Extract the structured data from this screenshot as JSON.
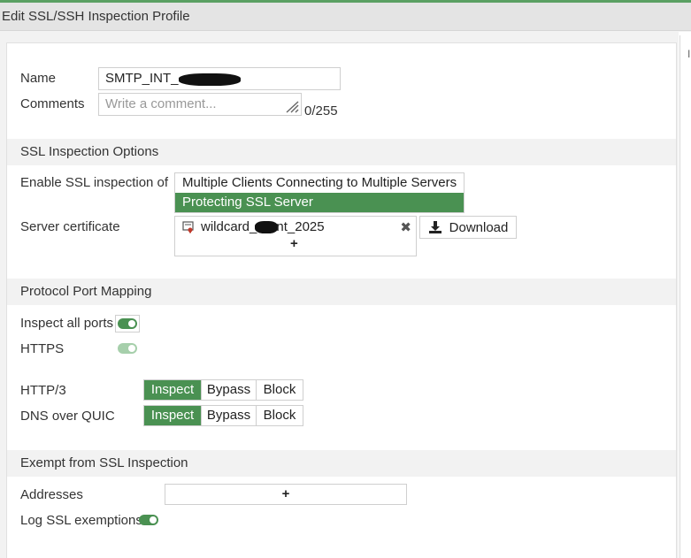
{
  "title": "Edit SSL/SSH Inspection Profile",
  "colors": {
    "accent": "#4a9152",
    "header_bg": "#e4e4e4",
    "section_bg": "#f2f2f2"
  },
  "form": {
    "name_label": "Name",
    "name_value": "SMTP_INT_",
    "comments_label": "Comments",
    "comments_placeholder": "Write a comment...",
    "comments_counter": "0/255"
  },
  "ssl_options": {
    "section_title": "SSL Inspection Options",
    "enable_label": "Enable SSL inspection of",
    "options": [
      {
        "label": "Multiple Clients Connecting to Multiple Servers",
        "selected": false
      },
      {
        "label": "Protecting SSL Server",
        "selected": true
      }
    ],
    "server_cert_label": "Server certificate",
    "cert_prefix": "wildcard_",
    "cert_suffix": "nt_2025",
    "cert_icon": "certificate-icon",
    "remove_icon": "close-icon",
    "add_symbol": "+",
    "download_label": "Download",
    "download_icon": "download-icon"
  },
  "port_mapping": {
    "section_title": "Protocol Port Mapping",
    "inspect_all_label": "Inspect all ports",
    "inspect_all_enabled": true,
    "https_label": "HTTPS",
    "https_enabled": true,
    "http3_label": "HTTP/3",
    "dns_quic_label": "DNS over QUIC",
    "segment_options": [
      "Inspect",
      "Bypass",
      "Block"
    ],
    "http3_selected": "Inspect",
    "dns_quic_selected": "Inspect"
  },
  "exempt": {
    "section_title": "Exempt from SSL Inspection",
    "addresses_label": "Addresses",
    "add_symbol": "+",
    "log_label": "Log SSL exemptions",
    "log_enabled": true
  }
}
